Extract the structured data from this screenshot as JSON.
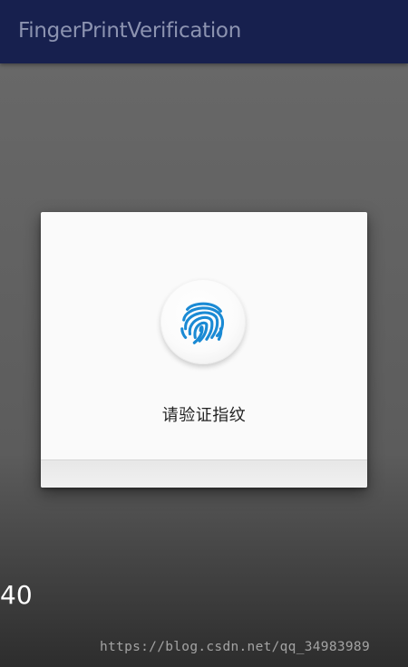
{
  "app_bar": {
    "title": "FingerPrintVerification",
    "background_color": "#17204e",
    "title_color": "#8c93b0"
  },
  "dialog": {
    "icon": "fingerprint-icon",
    "icon_color": "#1a8ad4",
    "prompt": "请验证指纹"
  },
  "overlay": {
    "counter": "40",
    "watermark": "https://blog.csdn.net/qq_34983989"
  }
}
